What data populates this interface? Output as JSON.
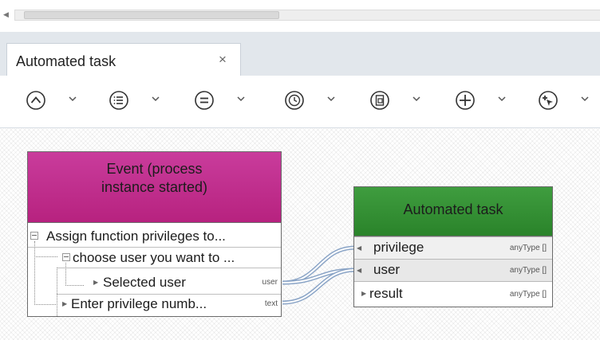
{
  "tab": {
    "title": "Automated task",
    "close_icon": "×"
  },
  "toolbar": {
    "buttons": [
      {
        "name": "collapse-up",
        "icon": "chevron-up-circle-icon"
      },
      {
        "name": "list",
        "icon": "list-circle-icon"
      },
      {
        "name": "equals",
        "icon": "equals-circle-icon"
      },
      {
        "name": "clock",
        "icon": "clock-circle-icon"
      },
      {
        "name": "document",
        "icon": "document-circle-icon"
      },
      {
        "name": "add",
        "icon": "plus-circle-icon"
      },
      {
        "name": "add-element",
        "icon": "plus-arrow-circle-icon"
      }
    ]
  },
  "event_node": {
    "title": "Event (process\ninstance started)",
    "color": "#b7227f",
    "rows": [
      {
        "label": "Assign function privileges to..."
      },
      {
        "label": "choose user you want to ..."
      },
      {
        "label": "Selected user",
        "type": "user"
      },
      {
        "label": "Enter privilege numb...",
        "type": "text"
      }
    ]
  },
  "automated_task_node": {
    "title": "Automated task",
    "color": "#2a832a",
    "ports": [
      {
        "label": "privilege",
        "type": "anyType []"
      },
      {
        "label": "user",
        "type": "anyType []"
      },
      {
        "label": "result",
        "type": "anyType []"
      }
    ]
  }
}
